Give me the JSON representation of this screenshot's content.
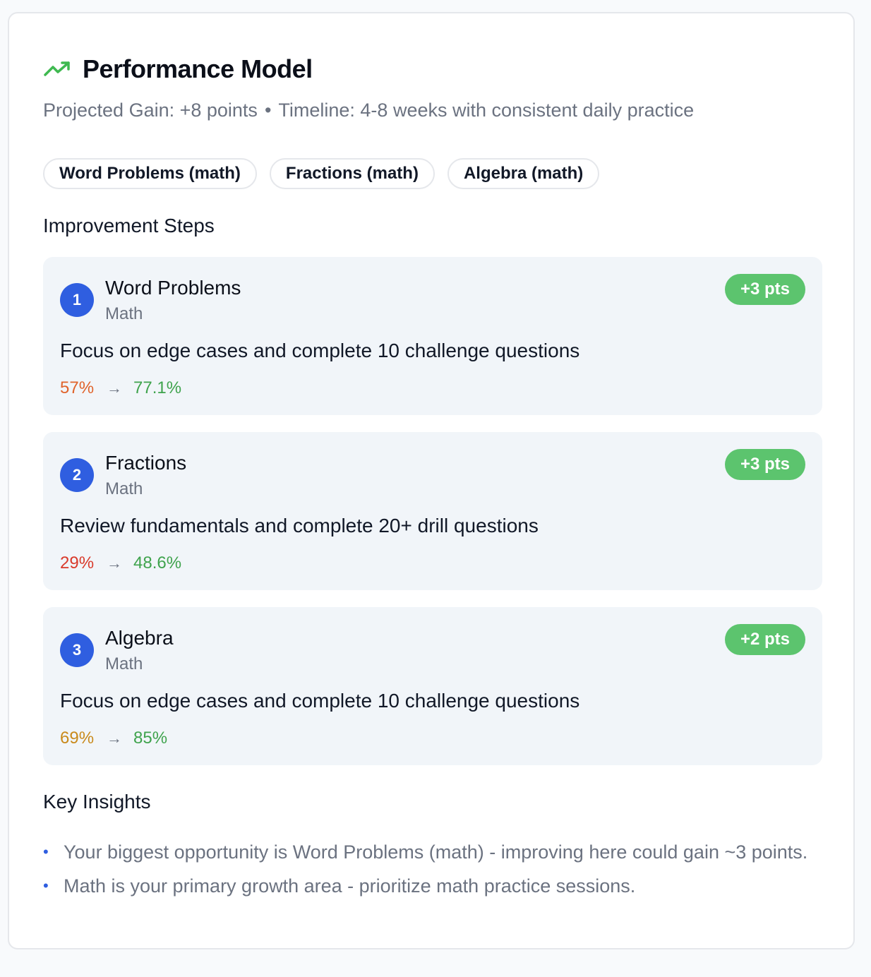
{
  "header": {
    "title": "Performance Model",
    "icon": "trending-up-icon",
    "icon_color": "#3fb950"
  },
  "summary": {
    "projected_gain": "Projected Gain: +8 points",
    "separator": "•",
    "timeline": "Timeline: 4-8 weeks with consistent daily practice"
  },
  "chips": [
    "Word Problems (math)",
    "Fractions (math)",
    "Algebra (math)"
  ],
  "steps_title": "Improvement Steps",
  "steps": [
    {
      "number": "1",
      "name": "Word Problems",
      "subject": "Math",
      "gain": "+3 pts",
      "description": "Focus on edge cases and complete 10 challenge questions",
      "from": "57%",
      "to": "77.1%",
      "from_color": "#e0632b"
    },
    {
      "number": "2",
      "name": "Fractions",
      "subject": "Math",
      "gain": "+3 pts",
      "description": "Review fundamentals and complete 20+ drill questions",
      "from": "29%",
      "to": "48.6%",
      "from_color": "#d93a2b"
    },
    {
      "number": "3",
      "name": "Algebra",
      "subject": "Math",
      "gain": "+2 pts",
      "description": "Focus on edge cases and complete 10 challenge questions",
      "from": "69%",
      "to": "85%",
      "from_color": "#c98a1c"
    }
  ],
  "arrow": "→",
  "insights_title": "Key Insights",
  "insights": [
    "Your biggest opportunity is Word Problems (math) - improving here could gain ~3 points.",
    "Math is your primary growth area - prioritize math practice sessions."
  ],
  "bullet": "•",
  "colors": {
    "accent_blue": "#2f5ee0",
    "gain_green": "#5cc46e",
    "target_green": "#3fa34d"
  }
}
